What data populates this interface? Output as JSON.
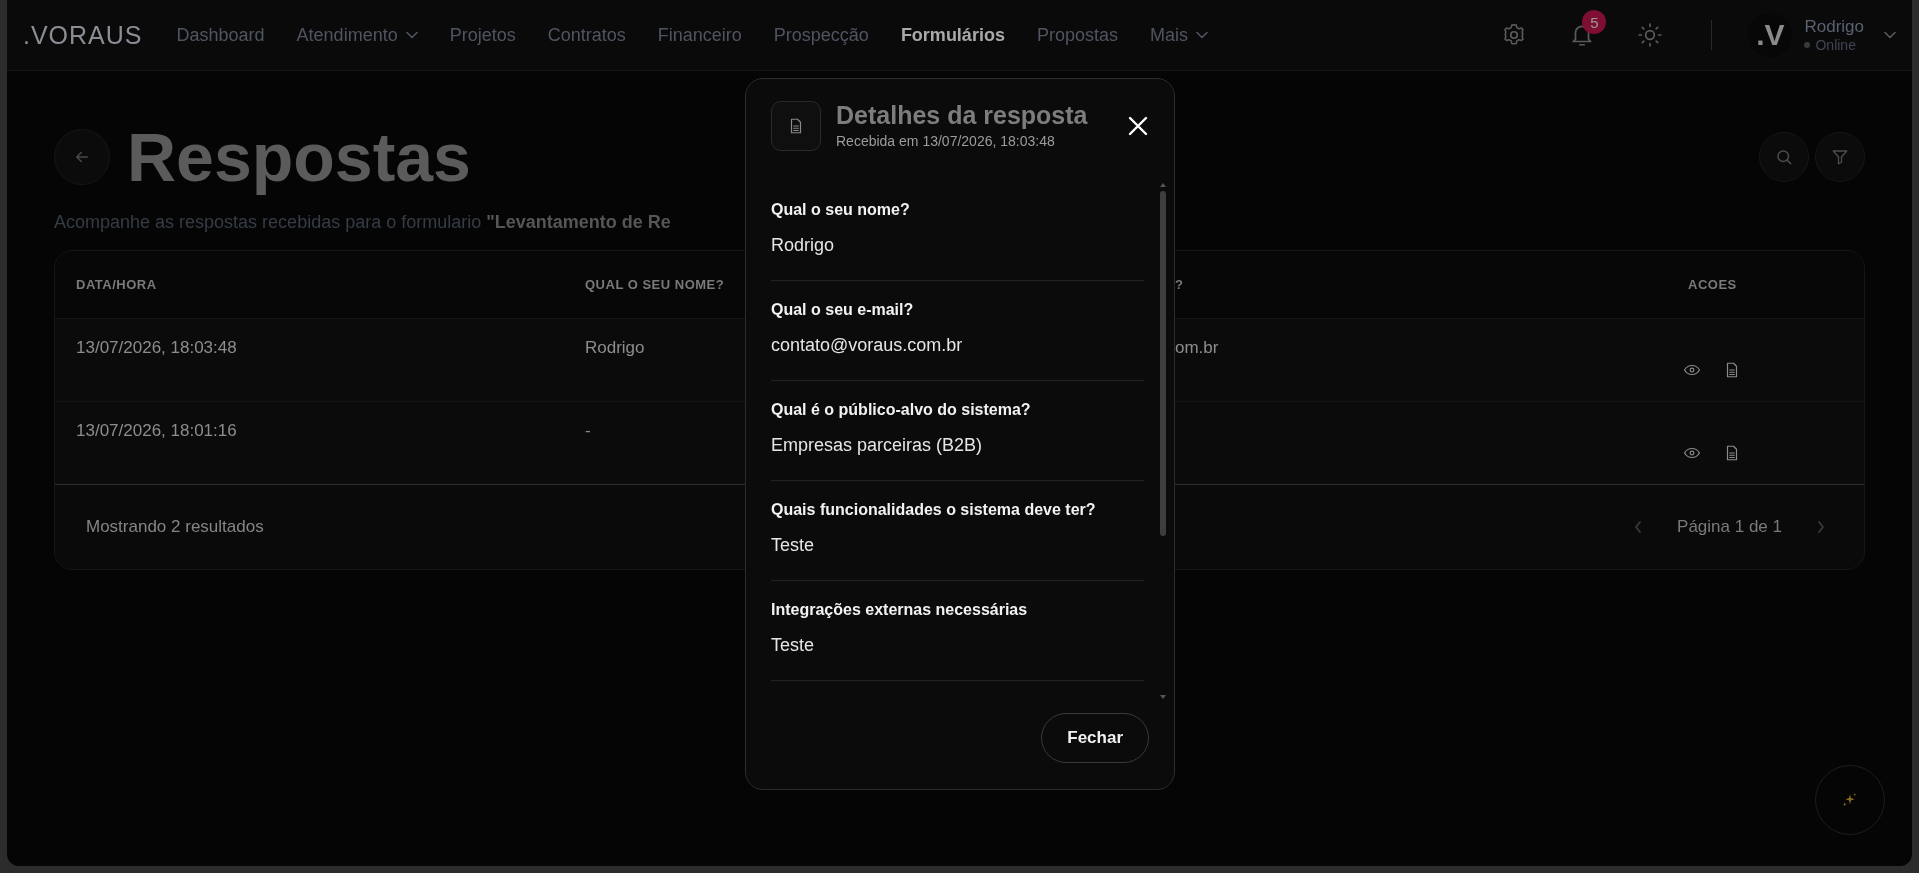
{
  "navbar": {
    "logo": ".VORAUS",
    "items": [
      {
        "label": "Dashboard",
        "selected": false,
        "has_menu": false
      },
      {
        "label": "Atendimento",
        "selected": false,
        "has_menu": true
      },
      {
        "label": "Projetos",
        "selected": false,
        "has_menu": false
      },
      {
        "label": "Contratos",
        "selected": false,
        "has_menu": false
      },
      {
        "label": "Financeiro",
        "selected": false,
        "has_menu": false
      },
      {
        "label": "Prospecção",
        "selected": false,
        "has_menu": false
      },
      {
        "label": "Formulários",
        "selected": true,
        "has_menu": false
      },
      {
        "label": "Propostas",
        "selected": false,
        "has_menu": false
      },
      {
        "label": "Mais",
        "selected": false,
        "has_menu": true
      }
    ],
    "notification_count": "5",
    "user": {
      "avatar": ".V",
      "name": "Rodrigo",
      "status": "Online"
    }
  },
  "page": {
    "title": "Respostas",
    "subtitle": "Acompanhe as respostas recebidas para o formulario **\"Levantamento de Re**"
  },
  "table": {
    "columns": [
      "DATA/HORA",
      "QUAL O SEU NOME?",
      "?",
      "ACOES"
    ],
    "rows": [
      {
        "cells": [
          "13/07/2026, 18:03:48",
          "Rodrigo",
          "om.br"
        ]
      },
      {
        "cells": [
          "13/07/2026, 18:01:16",
          "-"
        ]
      }
    ],
    "footer": "Mostrando 2 resultados",
    "pagination": "Página 1 de 1"
  },
  "modal": {
    "title": "Detalhes da resposta",
    "subtitle": "Recebida em 13/07/2026, 18:03:48",
    "fields": [
      {
        "question": "Qual o seu nome?",
        "answer": "Rodrigo"
      },
      {
        "question": "Qual o seu e-mail?",
        "answer": "contato@voraus.com.br"
      },
      {
        "question": "Qual é o público-alvo do sistema?",
        "answer": "Empresas parceiras (B2B)"
      },
      {
        "question": "Quais funcionalidades o sistema deve ter?",
        "answer": "Teste"
      },
      {
        "question": "Integrações externas necessárias",
        "answer": "Teste"
      }
    ],
    "close_button": "Fechar"
  }
}
